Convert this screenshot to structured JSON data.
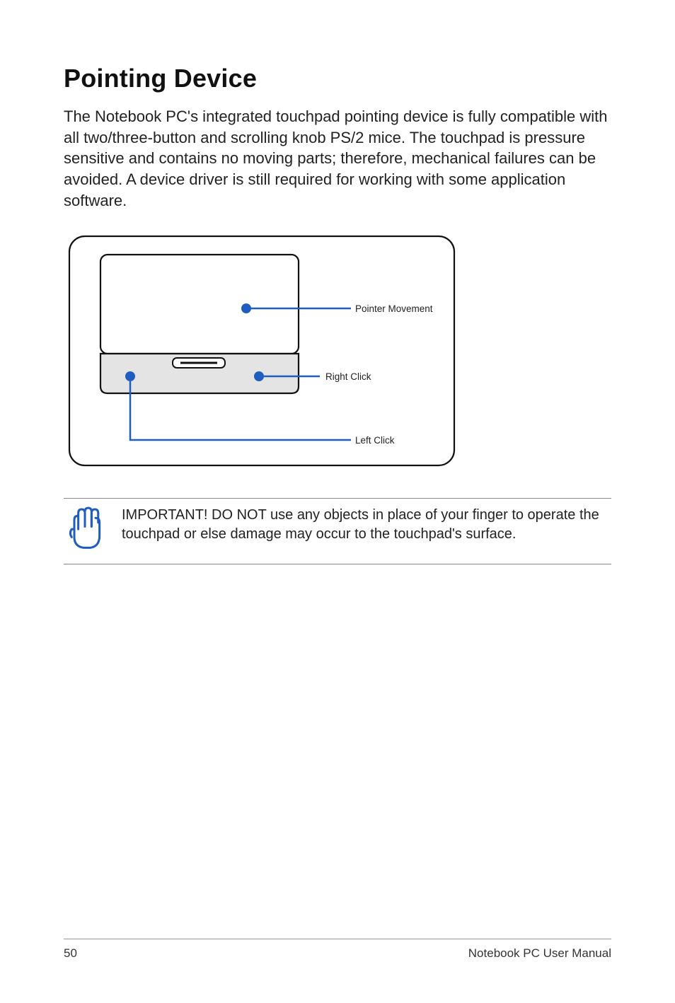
{
  "title": "Pointing Device",
  "body": "The Notebook PC's integrated touchpad pointing device is fully compatible with all two/three-button and scrolling knob PS/2 mice. The touchpad is pressure sensitive and contains no moving parts; therefore, mechanical failures can be avoided. A device driver is still required for working with some application software.",
  "figure": {
    "labels": {
      "pointer_movement": "Pointer Movement",
      "right_click": "Right Click",
      "left_click": "Left Click"
    }
  },
  "note": {
    "text": "IMPORTANT! DO NOT use any objects in place of your finger to operate the touchpad or else damage may occur to the touchpad's surface."
  },
  "footer": {
    "page_number": "50",
    "document": "Notebook PC User Manual"
  }
}
